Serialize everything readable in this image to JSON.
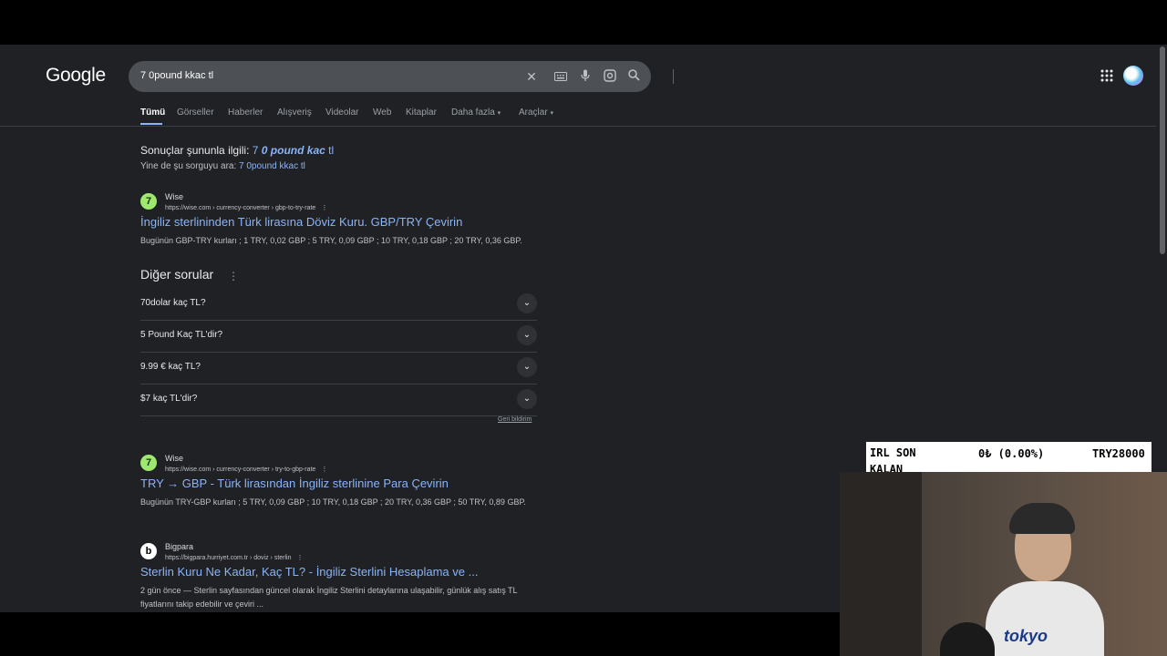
{
  "header": {
    "logo": "Google",
    "search_value": "7 0pound kkac tl"
  },
  "tabs": [
    "Tümü",
    "Görseller",
    "Haberler",
    "Alışveriş",
    "Videolar",
    "Web",
    "Kitaplar",
    "Daha fazla",
    "Araçlar"
  ],
  "spell": {
    "prefix": "Sonuçlar şununla ilgili:",
    "corrected_a": "7",
    "corrected_b": "0 pound kac",
    "corrected_c": "tl",
    "original_prefix": "Yine de şu sorguyu ara:",
    "original_query": "7 0pound kkac tl"
  },
  "results": [
    {
      "site": "Wise",
      "url": "https://wise.com › currency-converter › gbp-to-try-rate",
      "title": "İngiliz sterlininden Türk lirasına Döviz Kuru. GBP/TRY Çevirin",
      "snippet": "Bugünün GBP-TRY kurları ; 1 TRY, 0,02 GBP ; 5 TRY, 0,09 GBP ; 10 TRY, 0,18 GBP ; 20 TRY, 0,36 GBP."
    },
    {
      "site": "Wise",
      "url": "https://wise.com › currency-converter › try-to-gbp-rate",
      "title": "TRY → GBP - Türk lirasından İngiliz sterlinine Para Çevirin",
      "snippet": "Bugünün TRY-GBP kurları ; 5 TRY, 0,09 GBP ; 10 TRY, 0,18 GBP ; 20 TRY, 0,36 GBP ; 50 TRY, 0,89 GBP."
    },
    {
      "site": "Bigpara",
      "url": "https://bigpara.hurriyet.com.tr › doviz › sterlin",
      "title": "Sterlin Kuru Ne Kadar, Kaç TL? - İngiliz Sterlini Hesaplama ve ...",
      "snippet": "2 gün önce — Sterlin sayfasından güncel olarak İngiliz Sterlini detaylarına ulaşabilir, günlük alış satış TL fiyatlarını takip edebilir ve çeviri ..."
    }
  ],
  "paa": {
    "title": "Diğer sorular",
    "questions": [
      "70dolar kaç TL?",
      "5 Pound Kaç TL'dir?",
      "9.99 € kaç TL?",
      "$7 kaç TL'dir?"
    ],
    "feedback": "Geri bildirim"
  },
  "overlay": {
    "label": "IRL SON KALAN",
    "amount": "0₺ (0.00%)",
    "goal": "TRY28000"
  },
  "webcam": {
    "shirt_text": "tokyo"
  }
}
